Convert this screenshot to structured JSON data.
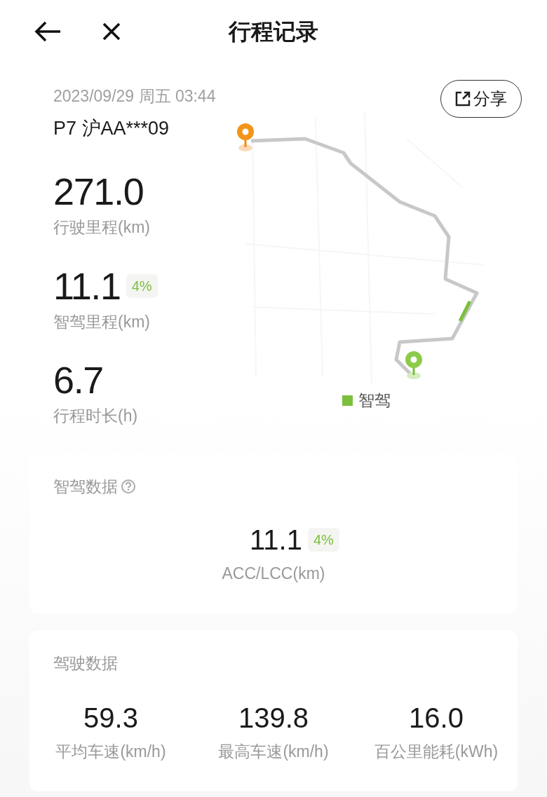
{
  "header": {
    "title": "行程记录"
  },
  "trip": {
    "datetime": "2023/09/29 周五 03:44",
    "vehicle": "P7 沪AA***09",
    "share": "分享"
  },
  "stats": [
    {
      "value": "271.0",
      "label": "行驶里程(km)"
    },
    {
      "value": "11.1",
      "badge": "4%",
      "label": "智驾里程(km)"
    },
    {
      "value": "6.7",
      "label": "行程时长(h)"
    }
  ],
  "map": {
    "legend": "智驾"
  },
  "assist_card": {
    "title": "智驾数据",
    "value": "11.1",
    "badge": "4%",
    "label": "ACC/LCC(km)"
  },
  "driving_card": {
    "title": "驾驶数据",
    "metrics": [
      {
        "value": "59.3",
        "label": "平均车速(km/h)"
      },
      {
        "value": "139.8",
        "label": "最高车速(km/h)"
      },
      {
        "value": "16.0",
        "label": "百公里能耗(kWh)"
      }
    ]
  }
}
